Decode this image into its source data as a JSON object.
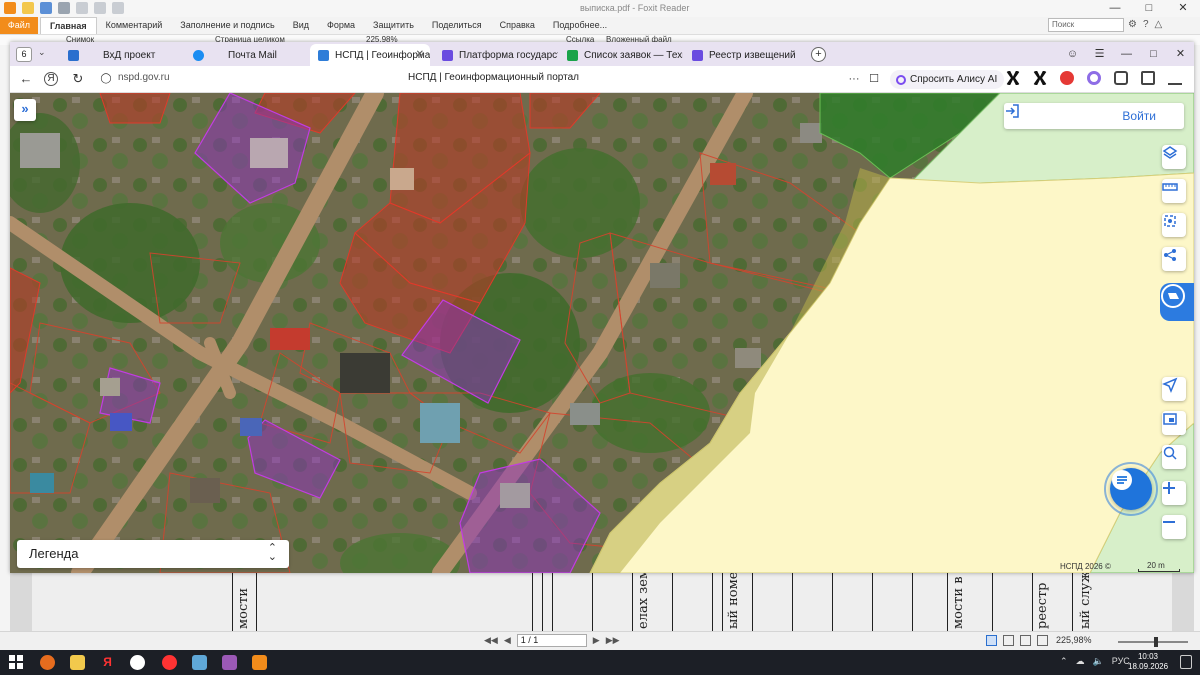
{
  "foxit": {
    "window_title": "выписка.pdf - Foxit Reader",
    "file_tab": "Файл",
    "ribbon_tabs": [
      "Главная",
      "Комментарий",
      "Заполнение и подпись",
      "Вид",
      "Форма",
      "Защитить",
      "Поделиться",
      "Справка",
      "Подробнее..."
    ],
    "search_placeholder": "Поиск",
    "toolbar_items": [
      "Снимок",
      "Страница целиком",
      "225.98%",
      "Ссылка",
      "Вложенный файл"
    ],
    "page_field": "1 / 1",
    "zoom": "225,98%",
    "doc_fragments": [
      "мости",
      "елах зем",
      "ый номе",
      "мости в",
      "реестр",
      "ый служ"
    ]
  },
  "taskbar": {
    "lang": "РУС",
    "time": "10:03",
    "date": "18.09.2026"
  },
  "browser": {
    "tab_count": "6",
    "tabs": [
      {
        "label": "ВхД проект",
        "color": "#2a6fce"
      },
      {
        "label": "Почта Mail",
        "color": "#1b8df2"
      },
      {
        "label": "НСПД | Геоинформац",
        "color": "#2e7dd8"
      },
      {
        "label": "Платформа государстве",
        "color": "#6a4be0"
      },
      {
        "label": "Список заявок — ТехноК",
        "color": "#1aa34a"
      },
      {
        "label": "Реестр извещений",
        "color": "#6a4be0"
      }
    ],
    "url": "nspd.gov.ru",
    "page_title": "НСПД | Геоинформационный портал",
    "alice_label": "Спросить Алису AI"
  },
  "map": {
    "login_label": "Войти",
    "legend_label": "Легенда",
    "attribution": "НСПД 2026 ©",
    "scale": "20 m",
    "colors": {
      "accent": "#2e6fd6",
      "parcel_red": "#c0392b",
      "parcel_purple": "#a32fd0",
      "zone_yellow": "#fdf7c8",
      "zone_green": "#d7efc9",
      "forest": "#2f7d2a"
    }
  }
}
